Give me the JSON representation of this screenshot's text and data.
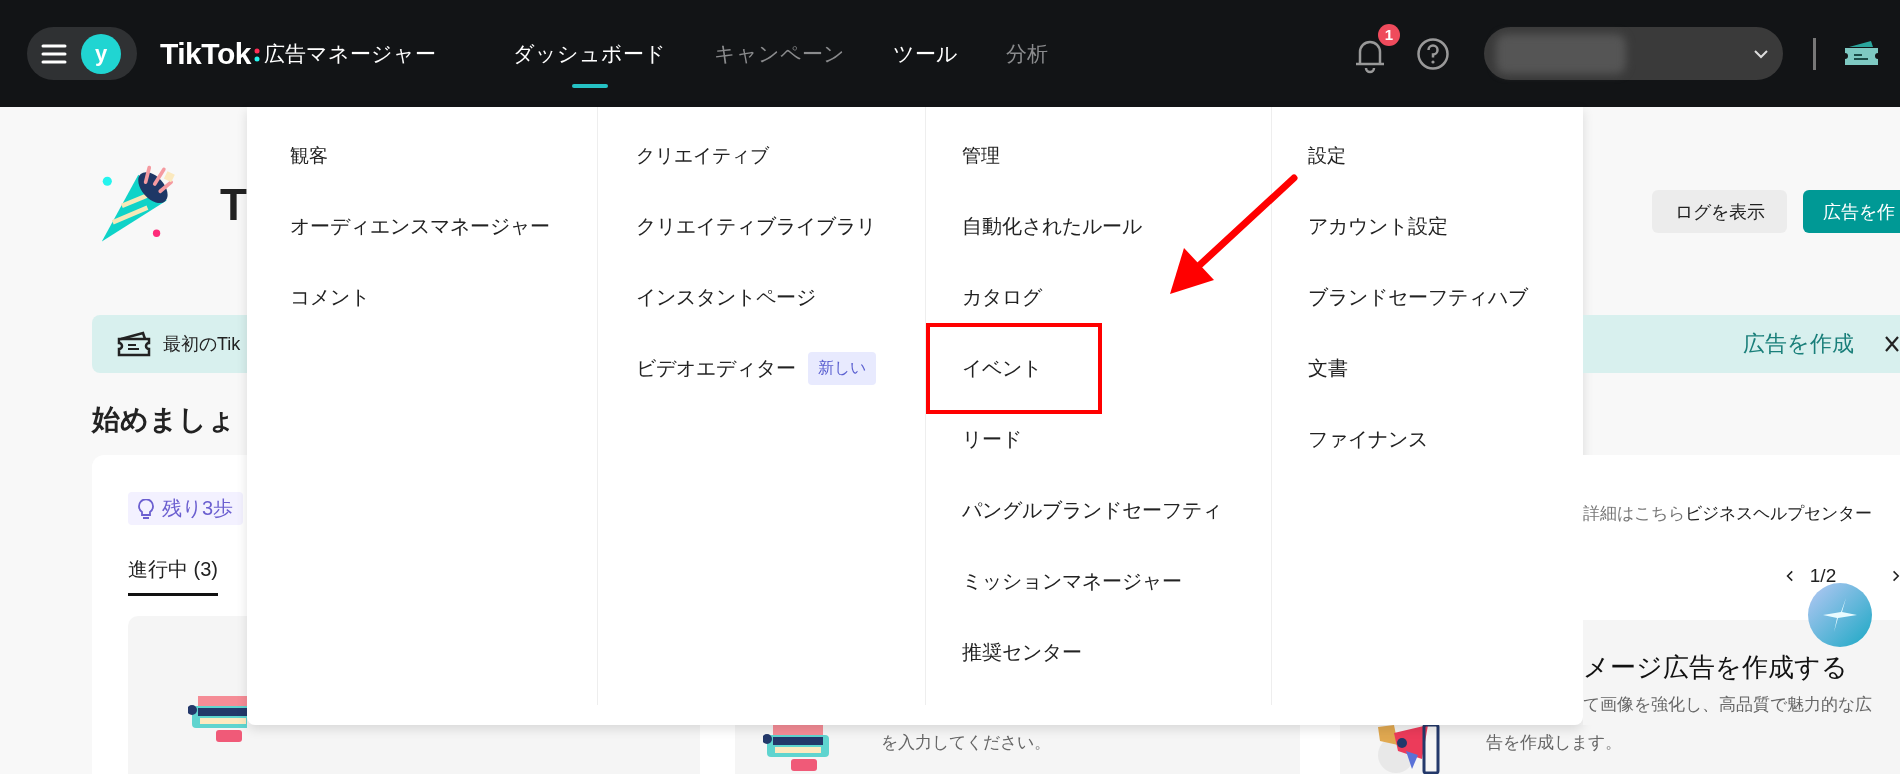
{
  "header": {
    "avatar_letter": "y",
    "logo": "TikTok",
    "product": "広告マネージャー",
    "notification_count": "1",
    "nav": [
      {
        "label": "ダッシュボード",
        "selected": true,
        "dimmed": false
      },
      {
        "label": "キャンペーン",
        "selected": false,
        "dimmed": true
      },
      {
        "label": "ツール",
        "selected": false,
        "dimmed": false
      },
      {
        "label": "分析",
        "selected": false,
        "dimmed": true
      }
    ]
  },
  "page_left": {
    "title": "T",
    "banner_text": "最初のTik",
    "heading": "始めましょ",
    "steps_badge": "残り3歩",
    "tabs": [
      {
        "label": "進行中 (3)",
        "selected": true
      }
    ]
  },
  "page_right": {
    "buttons": [
      {
        "label": "ログを表示",
        "kind": "secondary"
      },
      {
        "label": "広告を作",
        "kind": "primary"
      }
    ],
    "banner_link": "広告を作成",
    "help_text": "詳細はこちら",
    "help_link": "ビジネスヘルプセンター",
    "pager": "1/2",
    "card_title": "メージ広告を作成する",
    "card_text": "て画像を強化し、高品質で魅力的な広"
  },
  "page_bottom": {
    "card_texts": [
      "を入力してください。",
      "告を作成します。"
    ]
  },
  "menu": {
    "columns": [
      {
        "heading": "観客",
        "items": [
          {
            "label": "オーディエンスマネージャー",
            "highlighted": false
          },
          {
            "label": "コメント",
            "highlighted": false
          }
        ]
      },
      {
        "heading": "クリエイティブ",
        "items": [
          {
            "label": "クリエイティブライブラリ",
            "highlighted": false
          },
          {
            "label": "インスタントページ",
            "highlighted": false
          },
          {
            "label": "ビデオエディター",
            "badge": "新しい",
            "highlighted": false
          }
        ]
      },
      {
        "heading": "管理",
        "items": [
          {
            "label": "自動化されたルール",
            "highlighted": false
          },
          {
            "label": "カタログ",
            "highlighted": false
          },
          {
            "label": "イベント",
            "highlighted": true
          },
          {
            "label": "リード",
            "highlighted": false
          },
          {
            "label": "パングルブランドセーフティ",
            "highlighted": false
          },
          {
            "label": "ミッションマネージャー",
            "highlighted": false
          },
          {
            "label": "推奨センター",
            "highlighted": false
          }
        ]
      },
      {
        "heading": "設定",
        "items": [
          {
            "label": "アカウント設定",
            "highlighted": false
          },
          {
            "label": "ブランドセーフティハブ",
            "highlighted": false
          },
          {
            "label": "文書",
            "highlighted": false
          },
          {
            "label": "ファイナンス",
            "highlighted": false
          }
        ]
      }
    ]
  }
}
